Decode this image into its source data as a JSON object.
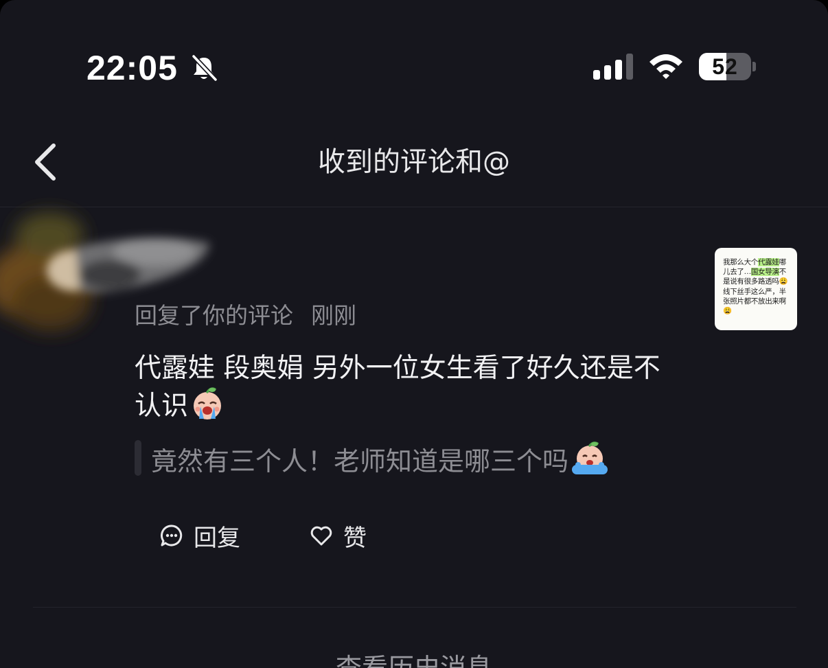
{
  "status_bar": {
    "time": "22:05",
    "battery_level": "52",
    "battery_fraction": 0.52,
    "signal_bars": 3,
    "icons": [
      "bell-off-icon",
      "signal-icon",
      "wifi-icon",
      "battery-icon"
    ]
  },
  "nav": {
    "back_icon": "chevron-left-icon",
    "title": "收到的评论和@"
  },
  "notification": {
    "action": "回复了你的评论",
    "time": "刚刚",
    "comment": "代露娃 段奥娟 另外一位女生看了好久还是不认识",
    "comment_emoji": "crying-face-emoji",
    "quoted": "竟然有三个人！老师知道是哪三个吗",
    "quoted_emoji": "crying-face-emoji",
    "thumbnail": {
      "segments": [
        {
          "text": "我那么大个",
          "highlight": false
        },
        {
          "text": "代露娃",
          "highlight": true
        },
        {
          "text": "哪儿去了…",
          "highlight": false
        },
        {
          "text": "国女导演",
          "highlight": true
        },
        {
          "text": "不是说有很多路透吗",
          "highlight": false
        },
        {
          "text": "😩",
          "highlight": false
        },
        {
          "text": "线下丝手这么严，半张照片都不放出来啊",
          "highlight": false
        },
        {
          "text": "😩",
          "highlight": false
        }
      ]
    }
  },
  "actions": {
    "reply_label": "回复",
    "like_label": "赞",
    "reply_icon": "comment-bubble-icon",
    "like_icon": "heart-icon"
  },
  "footer": {
    "history_label": "查看历史消息"
  },
  "colors": {
    "background": "#16161d",
    "primary_text": "#f2f2f4",
    "secondary_text": "#8d8d93",
    "thumbnail_highlight": "#b8f089"
  }
}
